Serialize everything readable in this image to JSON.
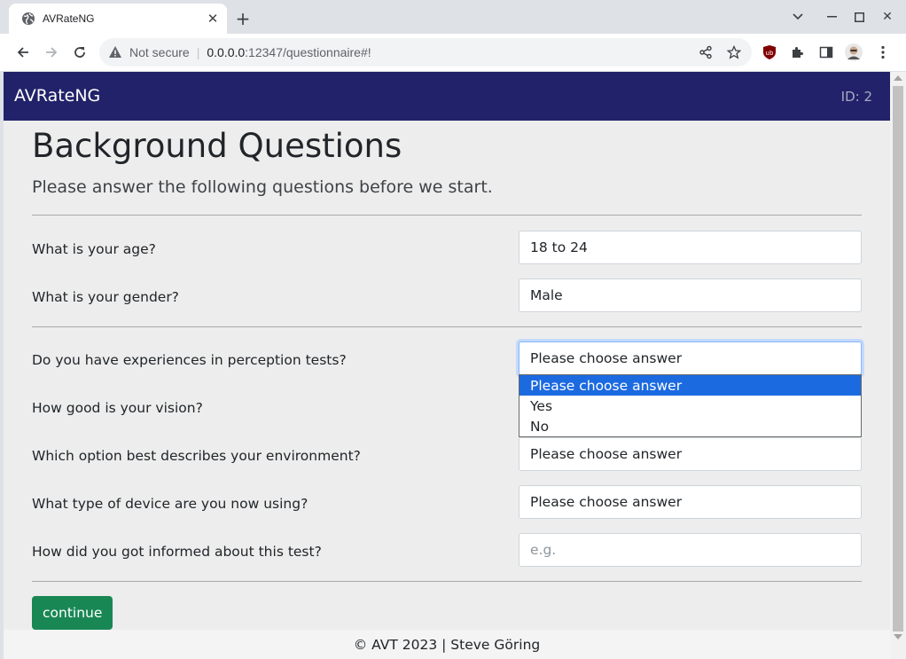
{
  "browser": {
    "tab_title": "AVRateNG",
    "omnibox": {
      "security_text": "Not secure",
      "host": "0.0.0.0",
      "path": ":12347/questionnaire#!"
    }
  },
  "navbar": {
    "brand": "AVRateNG",
    "id_label": "ID: 2"
  },
  "page": {
    "title": "Background Questions",
    "lead": "Please answer the following questions before we start."
  },
  "questions": [
    {
      "label": "What is your age?",
      "value": "18 to 24"
    },
    {
      "label": "What is your gender?",
      "value": "Male"
    },
    {
      "label": "Do you have experiences in perception tests?",
      "value": "Please choose answer"
    },
    {
      "label": "How good is your vision?",
      "value": ""
    },
    {
      "label": "Which option best describes your environment?",
      "value": "Please choose answer"
    },
    {
      "label": "What type of device are you now using?",
      "value": "Please choose answer"
    },
    {
      "label": "How did you got informed about this test?",
      "placeholder": "e.g."
    }
  ],
  "dropdown": {
    "options": [
      "Please choose answer",
      "Yes",
      "No"
    ],
    "selected_index": 0
  },
  "continue_label": "continue",
  "footer_text": "© AVT 2023 | Steve Göring",
  "colors": {
    "navbar": "#22226a",
    "continue_button": "#198754",
    "dropdown_highlight": "#1c6ae0"
  }
}
